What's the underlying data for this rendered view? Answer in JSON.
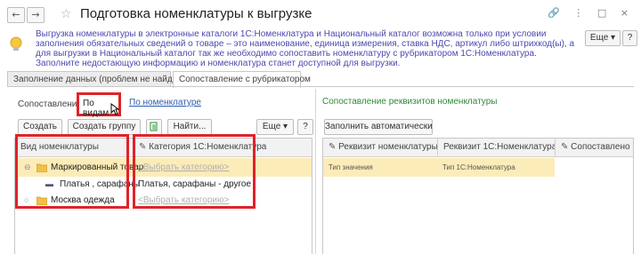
{
  "window": {
    "title": "Подготовка номенклатуры к выгрузке",
    "back_glyph": "←",
    "forward_glyph": "→",
    "favorite_glyph": "☆",
    "right_icons": "🔗 ⋮ □ ×"
  },
  "info": {
    "text": "Выгрузка номенклатуры в электронные каталоги 1С:Номенклатура и Национальный каталог возможна только при условии заполнения обязательных сведений о товаре – это наименование, единица измерения, ставка НДС, артикул либо штрихкод(ы), а для выгрузки в Национальный каталог так же необходимо сопоставить номенклатуру с рубрикатором 1С:Номенклатура.",
    "text2": "Заполните недостающую информацию и номенклатура станет доступной для выгрузки.",
    "more_label": "Еще ▾",
    "help_label": "?"
  },
  "tabs": [
    {
      "label": "Заполнение данных (проблем не найдено)",
      "active": false
    },
    {
      "label": "Сопоставление с рубрикатором",
      "active": true
    }
  ],
  "left": {
    "mapping_label": "Сопоставление:",
    "option_by_kinds": "По видам",
    "option_by_items": "По номенклатуре",
    "toolbar": {
      "create": "Создать",
      "create_group": "Создать группу",
      "find": "Найти...",
      "more": "Еще ▾",
      "help": "?"
    },
    "columns": [
      "Вид номенклатуры",
      "Категория 1С:Номенклатура"
    ],
    "rows": [
      {
        "kind": "Маркированный товар",
        "category": "<Выбрать категорию>"
      },
      {
        "kind": "Платья , сарафаны",
        "category": "Платья, сарафаны - другое"
      },
      {
        "kind": "Москва одежда",
        "category": "<Выбрать категорию>"
      }
    ]
  },
  "right": {
    "title": "Сопоставление реквизитов номенклатуры",
    "fill_auto": "Заполнить автоматически",
    "columns": [
      "Реквизит номенклатуры",
      "Реквизит 1С:Номенклатура",
      "Сопоставлено"
    ],
    "rows": [
      {
        "attr": "Тип значения",
        "attr_1c": "Тип 1С:Номенклатура"
      }
    ]
  },
  "colors": {
    "highlight_border": "#e0222a",
    "selected_row": "#fcecb8",
    "link": "#2b5fa8"
  }
}
